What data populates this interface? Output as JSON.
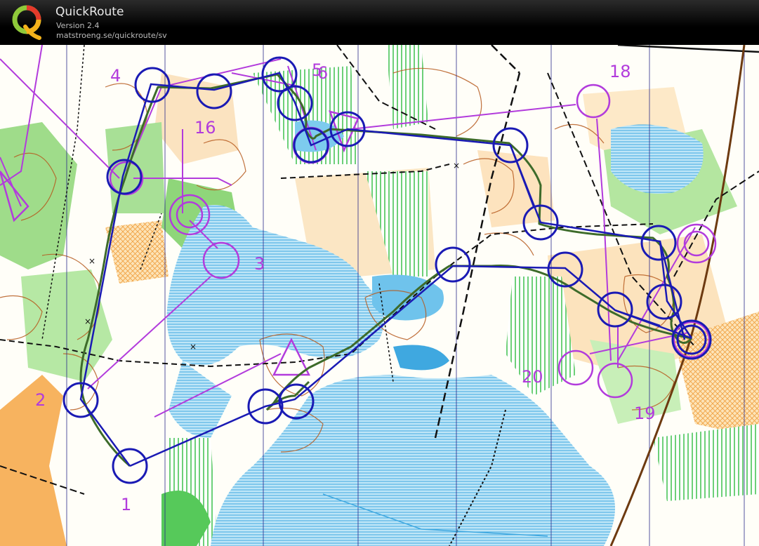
{
  "app": {
    "title": "QuickRoute",
    "version": "Version 2.4",
    "url": "matstroeng.se/quickroute/sv"
  },
  "colors": {
    "course": "#b23bdc",
    "route": "#1a1ab4",
    "gps_track": "#3d6b2a",
    "water": "#3fa8e0",
    "green": "#8fd67a",
    "open_land": "#fbc77b",
    "contour": "#b65a1e"
  },
  "course": {
    "control_labels": [
      "1",
      "2",
      "3",
      "4",
      "5",
      "6",
      "16",
      "18",
      "19",
      "20"
    ]
  }
}
